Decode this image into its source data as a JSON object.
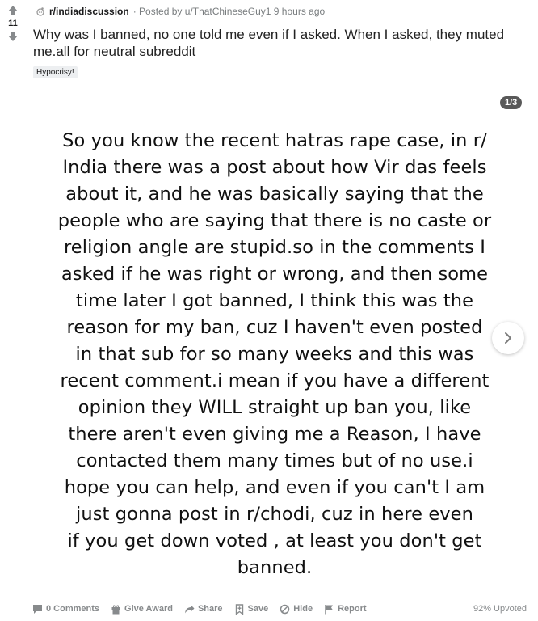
{
  "post": {
    "score": "11",
    "subreddit": "r/indiadiscussion",
    "posted_by": "· Posted by u/ThatChineseGuy1 9 hours ago",
    "title": "Why was I banned, no one told me even if I asked. When I asked, they muted me.all for neutral subreddit",
    "flair": "Hypocrisy!",
    "gallery_counter": "1/3",
    "image_text_lines": [
      "So you know the recent hatras rape case, in r/",
      "India there was a post about how Vir das feels",
      "about it, and he was basically saying that the",
      "people who are saying that there is no caste or",
      "religion angle are stupid.so in the comments I",
      "asked if he was right or wrong, and then some",
      "time later I got banned, I think this was the",
      "reason for my ban, cuz I haven't  even posted",
      "in that sub for so many weeks and this was",
      "recent comment.i mean if you have a different",
      "opinion they WILL straight up ban you, like",
      "there aren't even giving me a Reason, I have",
      "contacted them many times but of no use.i",
      "hope you can help, and even if you can't I am",
      "just gonna post in r/chodi, cuz in here even",
      "if you get down voted , at least you don't get",
      "banned."
    ]
  },
  "footer": {
    "comments": "0 Comments",
    "award": "Give Award",
    "share": "Share",
    "save": "Save",
    "hide": "Hide",
    "report": "Report",
    "upvoted": "92% Upvoted"
  },
  "icons": {
    "upvote": "upvote-arrow-icon",
    "downvote": "downvote-arrow-icon",
    "subreddit": "subreddit-icon",
    "next": "chevron-right-icon"
  }
}
